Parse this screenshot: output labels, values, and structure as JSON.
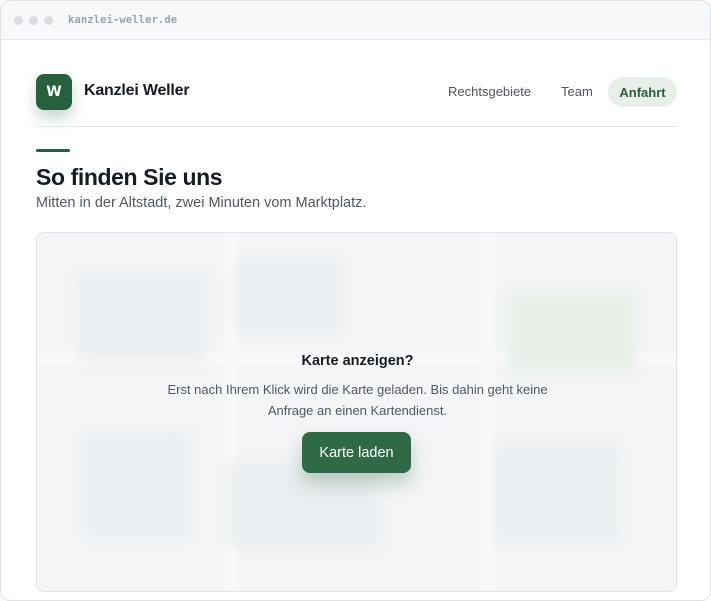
{
  "browser": {
    "url": "kanzlei-weller.de"
  },
  "header": {
    "logo_letter": "W",
    "brand": "Kanzlei Weller",
    "nav": [
      {
        "label": "Rechtsgebiete",
        "active": false
      },
      {
        "label": "Team",
        "active": false
      },
      {
        "label": "Anfahrt",
        "active": true
      }
    ]
  },
  "main": {
    "title": "So finden Sie uns",
    "subtitle": "Mitten in der Altstadt, zwei Minuten vom Marktplatz."
  },
  "map_consent": {
    "title": "Karte anzeigen?",
    "text": "Erst nach Ihrem Klick wird die Karte geladen. Bis dahin geht keine Anfrage an einen Kartendienst.",
    "button_label": "Karte laden"
  },
  "colors": {
    "accent": "#26603d",
    "accent_light": "#e8efe9",
    "text_dark": "#151c28",
    "text_muted": "#4d5868"
  }
}
